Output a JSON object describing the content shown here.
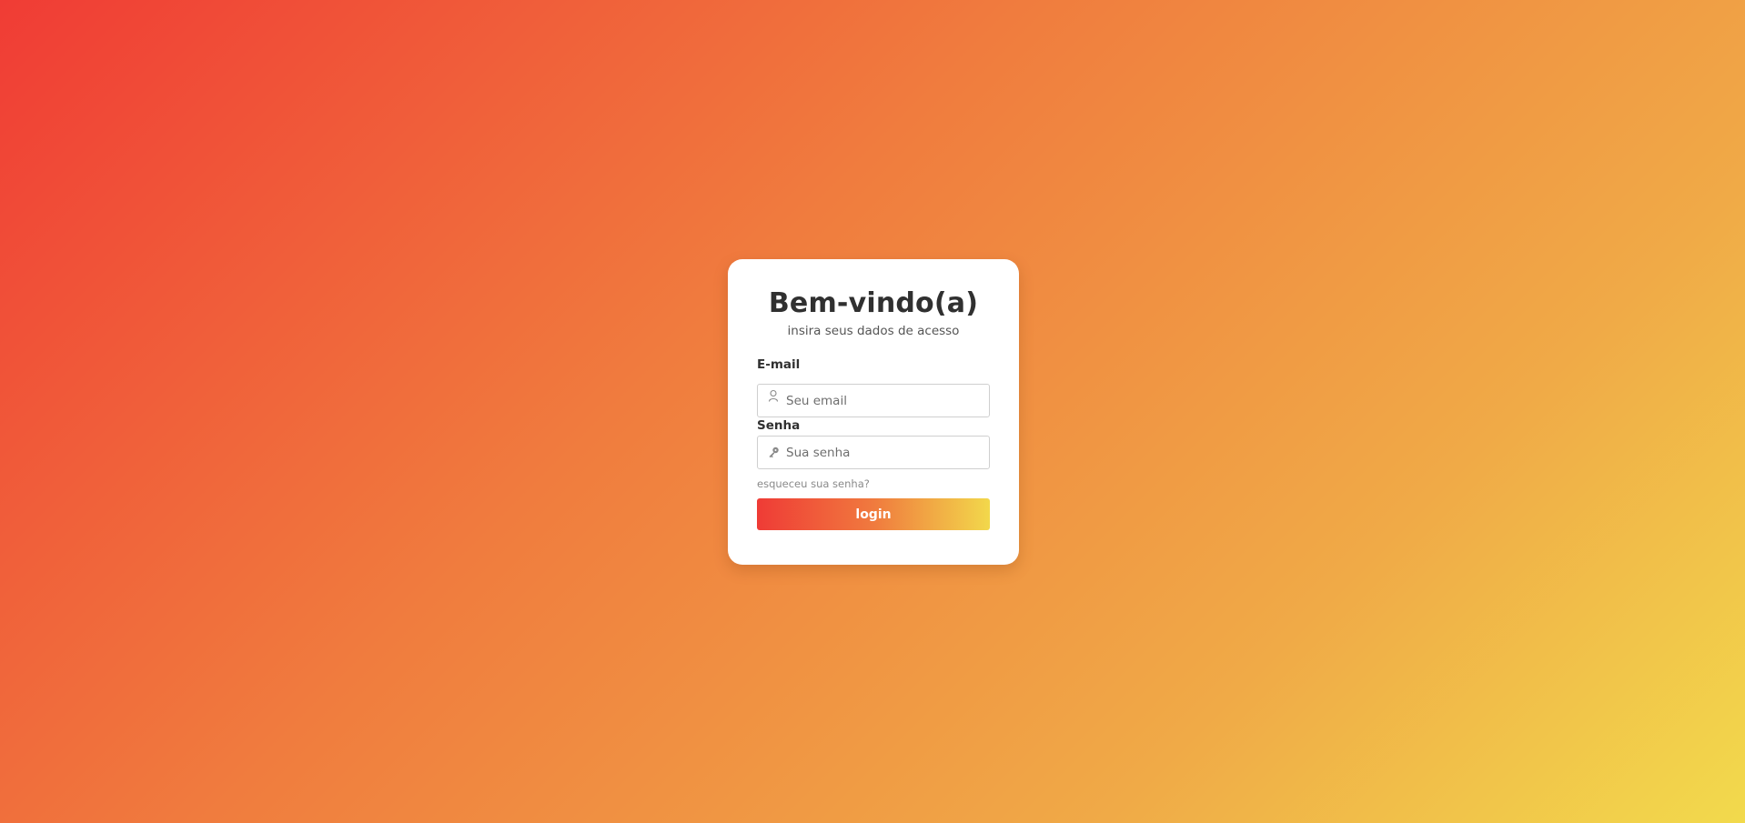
{
  "login_card": {
    "title": "Bem-vindo(a)",
    "subtitle": "insira seus dados de acesso",
    "email_label": "E-mail",
    "email_placeholder": "Seu email",
    "email_value": "",
    "email_icon": "user-icon",
    "password_label": "Senha",
    "password_placeholder": "Sua senha",
    "password_value": "",
    "password_icon": "key-icon",
    "forgot_link": "esqueceu sua senha?",
    "login_button": "login"
  },
  "colors": {
    "gradient_start": "#f03c35",
    "gradient_end": "#f2da4c",
    "card_background": "#ffffff",
    "text_dark": "#303030"
  }
}
